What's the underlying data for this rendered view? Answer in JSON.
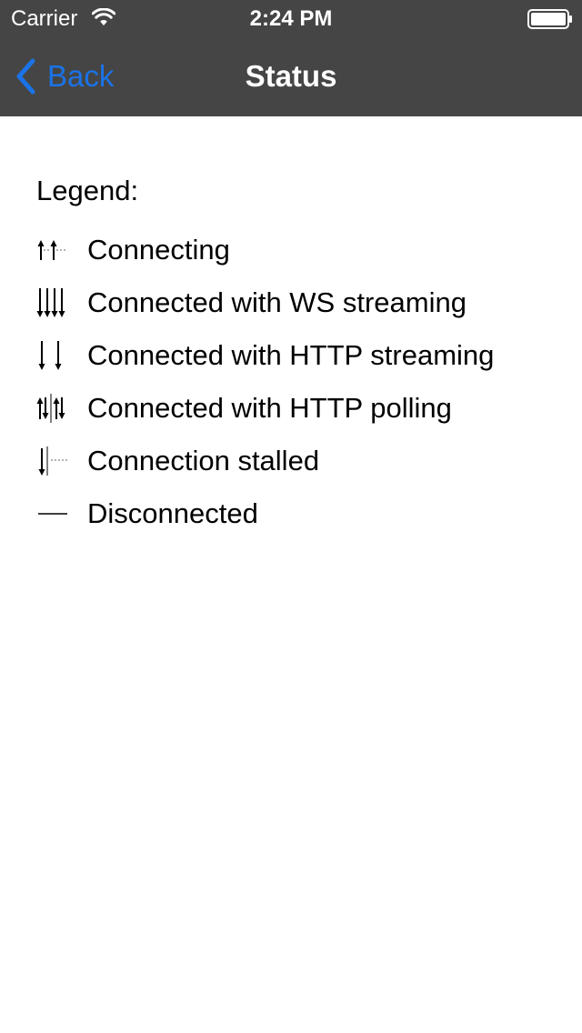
{
  "status_bar": {
    "carrier": "Carrier",
    "time": "2:24 PM",
    "wifi_icon": "wifi-icon",
    "battery_icon": "battery-icon"
  },
  "nav_bar": {
    "back_label": "Back",
    "title": "Status",
    "back_color": "#1a73e8",
    "background_color": "#454545"
  },
  "legend": {
    "title": "Legend:",
    "items": [
      {
        "icon": "connecting-icon",
        "label": "Connecting"
      },
      {
        "icon": "ws-streaming-icon",
        "label": "Connected with WS streaming"
      },
      {
        "icon": "http-streaming-icon",
        "label": "Connected with HTTP streaming"
      },
      {
        "icon": "http-polling-icon",
        "label": "Connected with HTTP polling"
      },
      {
        "icon": "stalled-icon",
        "label": "Connection stalled"
      },
      {
        "icon": "disconnected-icon",
        "label": "Disconnected"
      }
    ]
  }
}
